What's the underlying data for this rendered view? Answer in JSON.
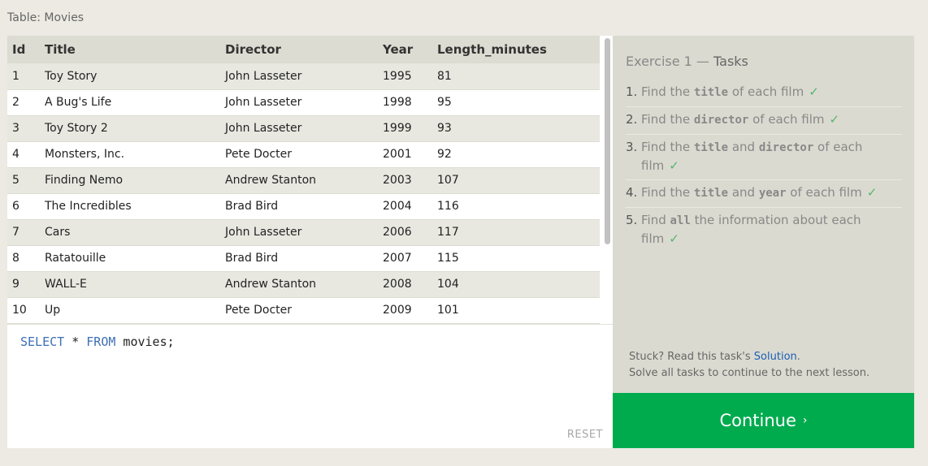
{
  "table_caption": "Table: Movies",
  "table": {
    "columns": [
      "Id",
      "Title",
      "Director",
      "Year",
      "Length_minutes"
    ],
    "rows": [
      [
        "1",
        "Toy Story",
        "John Lasseter",
        "1995",
        "81"
      ],
      [
        "2",
        "A Bug's Life",
        "John Lasseter",
        "1998",
        "95"
      ],
      [
        "3",
        "Toy Story 2",
        "John Lasseter",
        "1999",
        "93"
      ],
      [
        "4",
        "Monsters, Inc.",
        "Pete Docter",
        "2001",
        "92"
      ],
      [
        "5",
        "Finding Nemo",
        "Andrew Stanton",
        "2003",
        "107"
      ],
      [
        "6",
        "The Incredibles",
        "Brad Bird",
        "2004",
        "116"
      ],
      [
        "7",
        "Cars",
        "John Lasseter",
        "2006",
        "117"
      ],
      [
        "8",
        "Ratatouille",
        "Brad Bird",
        "2007",
        "115"
      ],
      [
        "9",
        "WALL-E",
        "Andrew Stanton",
        "2008",
        "104"
      ],
      [
        "10",
        "Up",
        "Pete Docter",
        "2009",
        "101"
      ]
    ]
  },
  "editor": {
    "kw1": "SELECT",
    "star": " * ",
    "kw2": "FROM",
    "rest": " movies;",
    "reset_label": "RESET"
  },
  "tasks": {
    "exercise": "Exercise 1",
    "dash": " — ",
    "title": "Tasks",
    "check": "✓",
    "items": [
      {
        "num": "1.",
        "parts": [
          "Find the ",
          "title",
          " of each film"
        ]
      },
      {
        "num": "2.",
        "parts": [
          "Find the ",
          "director",
          " of each film"
        ]
      },
      {
        "num": "3.",
        "parts": [
          "Find the ",
          "title",
          " and ",
          "director",
          " of each film"
        ]
      },
      {
        "num": "4.",
        "parts": [
          "Find the ",
          "title",
          " and ",
          "year",
          " of each film"
        ]
      },
      {
        "num": "5.",
        "parts": [
          "Find ",
          "all",
          " the information about each film"
        ]
      }
    ]
  },
  "help": {
    "stuck_prefix": "Stuck? Read this task's ",
    "solution_link": "Solution",
    "stuck_suffix": ".",
    "line2": "Solve all tasks to continue to the next lesson."
  },
  "continue_label": "Continue",
  "continue_chevron": "›"
}
